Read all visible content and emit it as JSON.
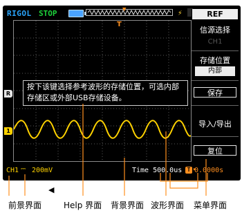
{
  "topbar": {
    "brand": "RIGOL",
    "run_state": "STOP"
  },
  "help_text": "按下该键选择参考波形的存储位置，可选内部存储区或外部USB存储设备。",
  "markers": {
    "ref": "R",
    "ch1": "1",
    "trigger": "T"
  },
  "menu": {
    "title": "REF",
    "items": [
      {
        "label": "信源选择",
        "value": "CH1"
      },
      {
        "label": "存储位置",
        "value": "内部"
      }
    ],
    "buttons": [
      "保存",
      "导入/导出",
      "复位"
    ]
  },
  "bottombar": {
    "channel": "CH1",
    "scale": "200mV",
    "time": "Time 500.0us",
    "trigger_offset": "0.0000s"
  },
  "captions": [
    "前景界面",
    "Help 界面",
    "背景界面",
    "波形界面",
    "菜单界面"
  ],
  "colors": {
    "screen_bg": "#000000",
    "channel1": "#ffd200",
    "brand": "#2aa6ff",
    "run_state": "#1ed33b",
    "trigger": "#ff8f1f"
  }
}
